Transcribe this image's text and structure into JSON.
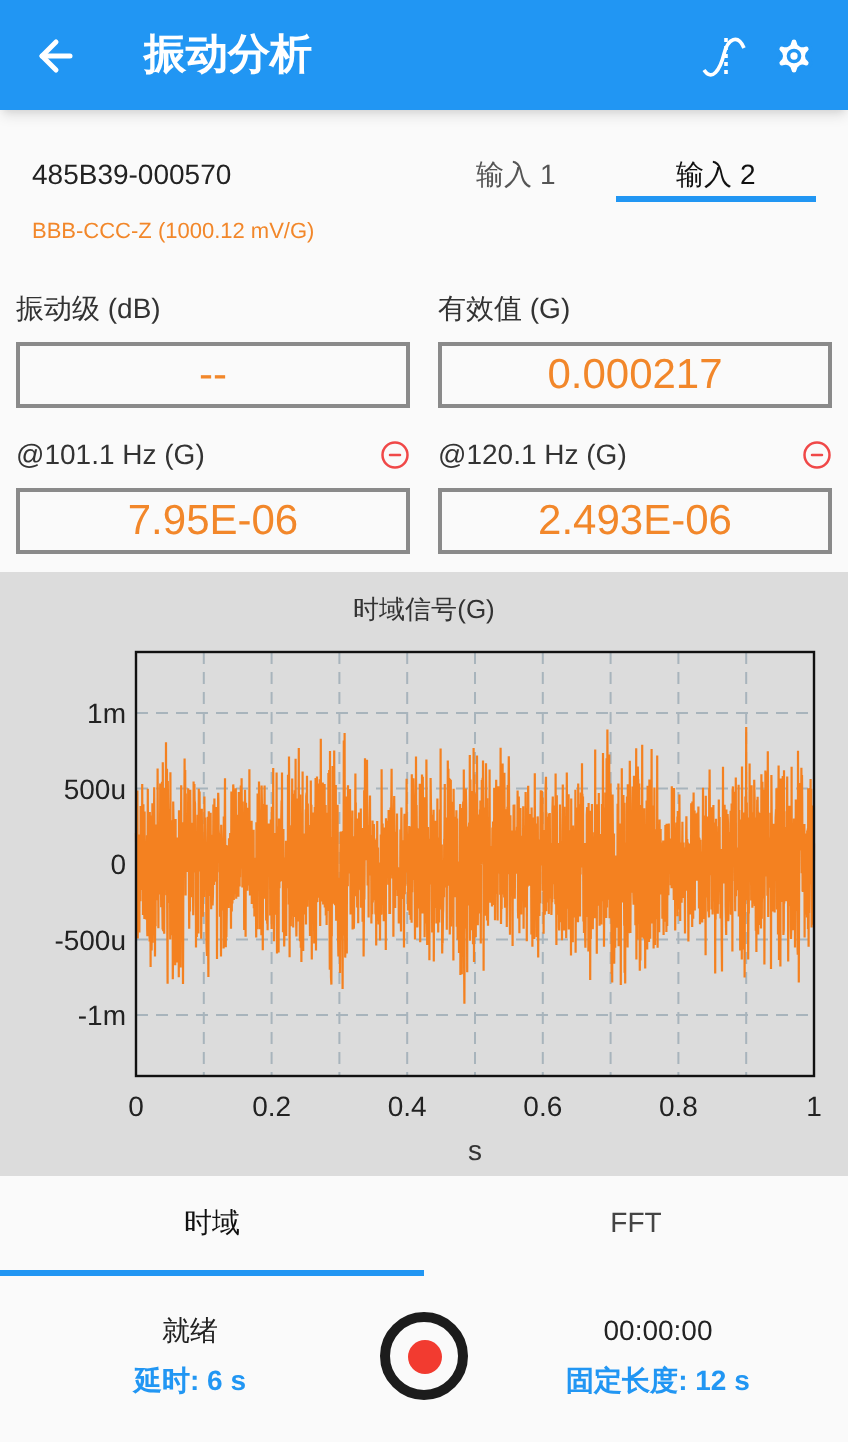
{
  "app_bar": {
    "title": "振动分析"
  },
  "sensor": {
    "serial": "485B39-000570",
    "detail": "BBB-CCC-Z (1000.12 mV/G)"
  },
  "input_tabs": [
    {
      "label": "输入 1",
      "selected": false
    },
    {
      "label": "输入 2",
      "selected": true
    }
  ],
  "measurements": [
    {
      "label": "振动级 (dB)",
      "value": "--",
      "removable": false
    },
    {
      "label": "有效值 (G)",
      "value": "0.000217",
      "removable": false
    },
    {
      "label": "@101.1 Hz (G)",
      "value": "7.95E-06",
      "removable": true
    },
    {
      "label": "@120.1 Hz (G)",
      "value": "2.493E-06",
      "removable": true
    }
  ],
  "chart": {
    "title": "时域信号(G)",
    "y_ticks": [
      "1m",
      "500u",
      "0",
      "-500u",
      "-1m"
    ],
    "x_ticks": [
      "0",
      "0.2",
      "0.4",
      "0.6",
      "0.8",
      "1"
    ],
    "xlabel": "s"
  },
  "view_tabs": [
    {
      "label": "时域",
      "selected": true
    },
    {
      "label": "FFT",
      "selected": false
    }
  ],
  "footer": {
    "status": "就绪",
    "delay": "延时: 6 s",
    "timer": "00:00:00",
    "length": "固定长度: 12 s"
  }
}
